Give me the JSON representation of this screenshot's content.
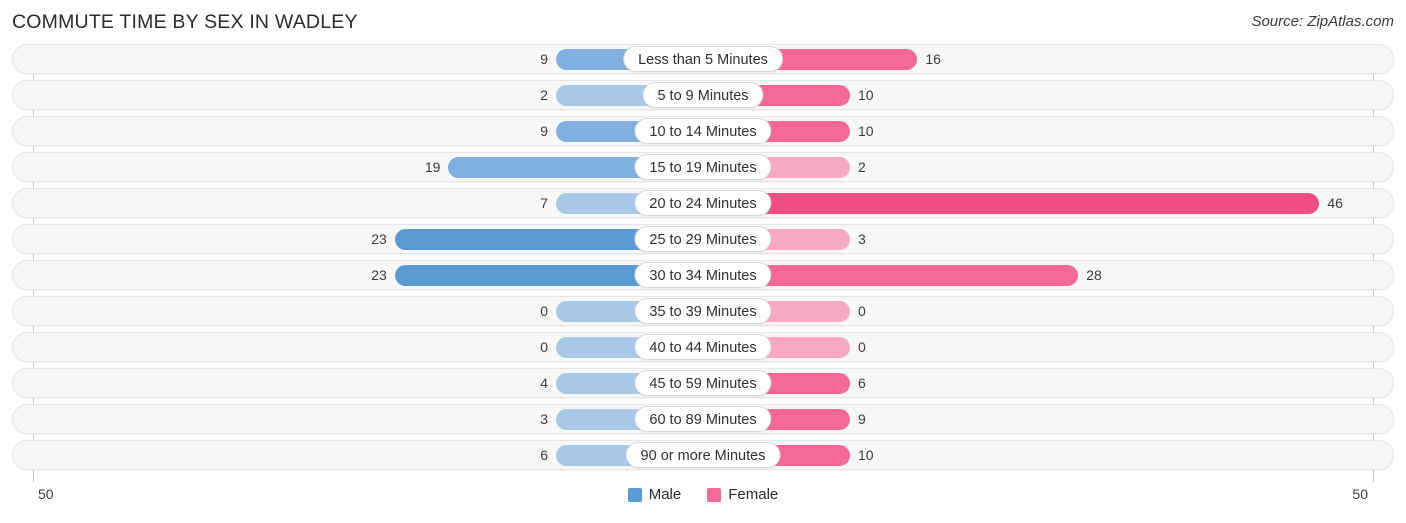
{
  "header": {
    "title": "COMMUTE TIME BY SEX IN WADLEY",
    "source": "Source: ZipAtlas.com"
  },
  "axis": {
    "left_end_label": "50",
    "right_end_label": "50",
    "max": 50
  },
  "legend": {
    "items": [
      {
        "label": "Male",
        "color": "#5b9bd5"
      },
      {
        "label": "Female",
        "color": "#f4689a"
      }
    ]
  },
  "colors": {
    "male_strong": "#5b9bd5",
    "male_mid": "#7fb0e0",
    "male_light": "#a8c8e8",
    "female_strong": "#f04e87",
    "female_mid": "#f4689a",
    "female_light": "#f9a8c4",
    "track_bg": "#f7f7f7",
    "track_border": "#e6e6e6",
    "axis_line": "#c9c9c9"
  },
  "chart_data": {
    "type": "bar",
    "title": "COMMUTE TIME BY SEX IN WADLEY",
    "subtitle": "",
    "xlabel": "",
    "ylabel": "",
    "orientation": "horizontal-diverging",
    "xlim": [
      50,
      50
    ],
    "grid": false,
    "legend_position": "bottom-center",
    "categories": [
      "Less than 5 Minutes",
      "5 to 9 Minutes",
      "10 to 14 Minutes",
      "15 to 19 Minutes",
      "20 to 24 Minutes",
      "25 to 29 Minutes",
      "30 to 34 Minutes",
      "35 to 39 Minutes",
      "40 to 44 Minutes",
      "45 to 59 Minutes",
      "60 to 89 Minutes",
      "90 or more Minutes"
    ],
    "series": [
      {
        "name": "Male",
        "side": "left",
        "color": "#5b9bd5",
        "values": [
          9,
          2,
          9,
          19,
          7,
          23,
          23,
          0,
          0,
          4,
          3,
          6
        ]
      },
      {
        "name": "Female",
        "side": "right",
        "color": "#f4689a",
        "values": [
          16,
          10,
          10,
          2,
          46,
          3,
          28,
          0,
          0,
          6,
          9,
          10
        ]
      }
    ]
  }
}
